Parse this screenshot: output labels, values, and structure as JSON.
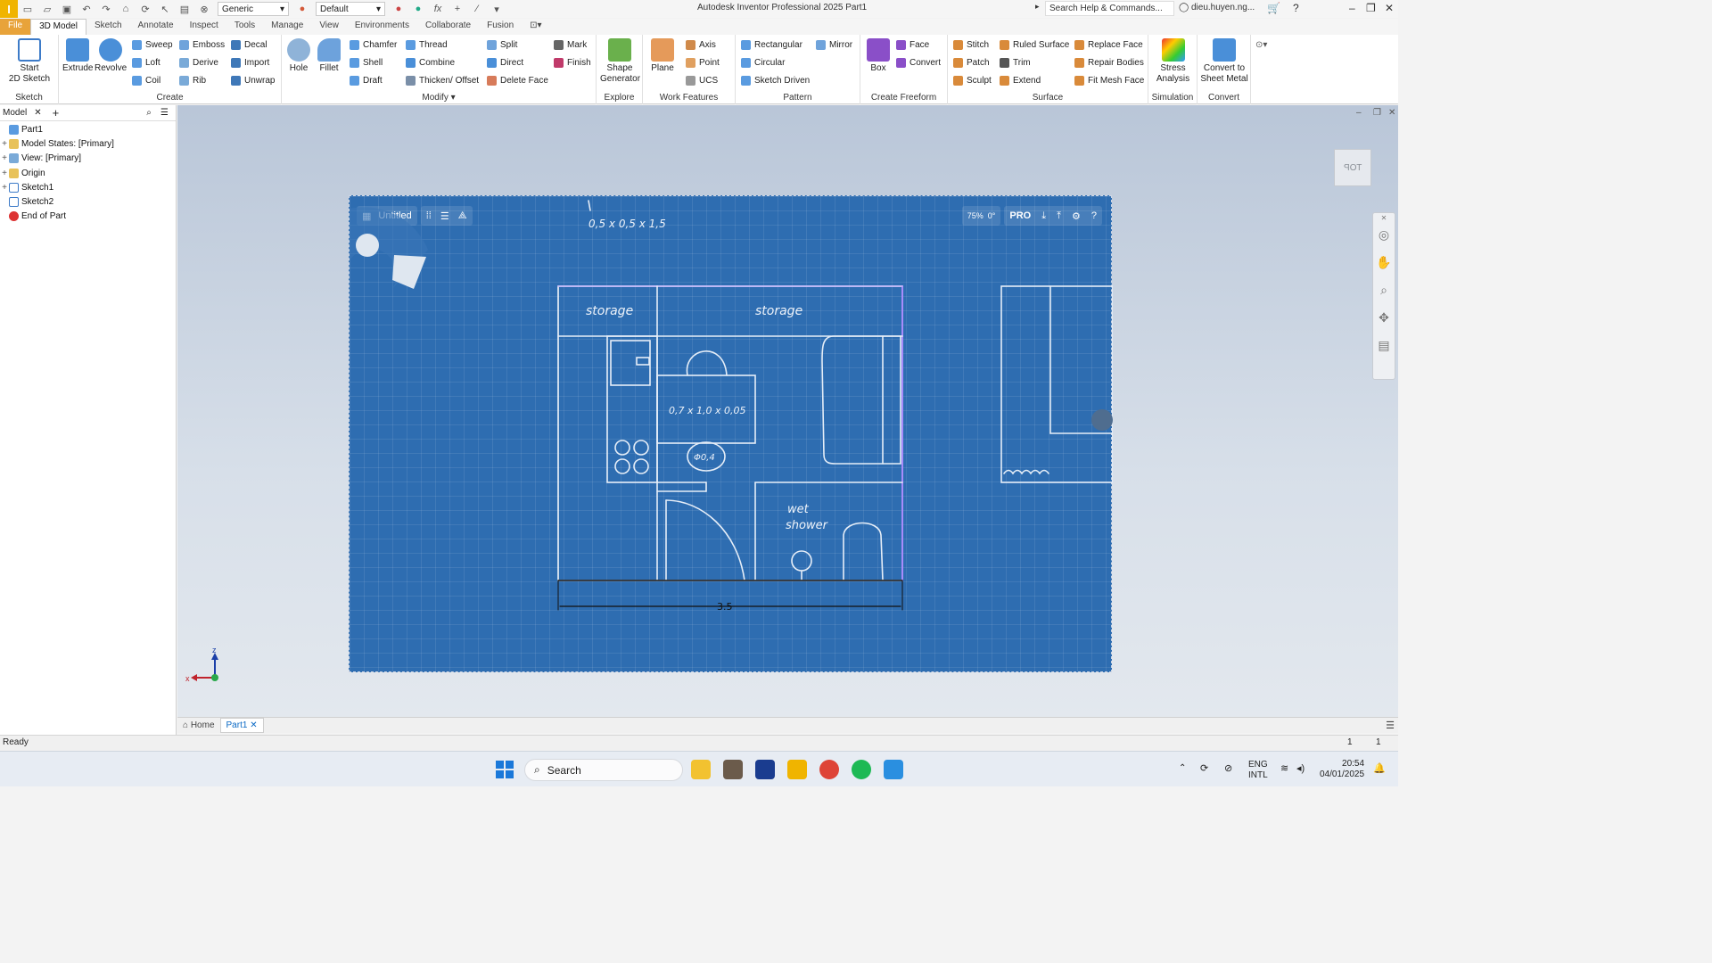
{
  "titlebar": {
    "material": "Generic",
    "appearance": "Default",
    "title": "Autodesk Inventor Professional 2025     Part1",
    "search_placeholder": "Search Help & Commands...",
    "user": "dieu.huyen.ng...",
    "fx_symbol": "fx"
  },
  "tabs": [
    "File",
    "3D Model",
    "Sketch",
    "Annotate",
    "Inspect",
    "Tools",
    "Manage",
    "View",
    "Environments",
    "Collaborate",
    "Fusion"
  ],
  "ribbon": {
    "sketch": {
      "label": "Sketch",
      "start": "Start",
      "start2": "2D Sketch"
    },
    "create": {
      "label": "Create",
      "extrude": "Extrude",
      "revolve": "Revolve",
      "sweep": "Sweep",
      "emboss": "Emboss",
      "decal": "Decal",
      "loft": "Loft",
      "derive": "Derive",
      "import": "Import",
      "coil": "Coil",
      "rib": "Rib",
      "unwrap": "Unwrap"
    },
    "modify": {
      "label": "Modify",
      "hole": "Hole",
      "fillet": "Fillet",
      "chamfer": "Chamfer",
      "thread": "Thread",
      "split": "Split",
      "shell": "Shell",
      "combine": "Combine",
      "direct": "Direct",
      "draft": "Draft",
      "thicken": "Thicken/ Offset",
      "delete_face": "Delete Face"
    },
    "explore": {
      "label": "Explore",
      "mark": "Mark",
      "finish": "Finish",
      "shape": "Shape",
      "generator": "Generator"
    },
    "work": {
      "label": "Work Features",
      "plane": "Plane",
      "axis": "Axis",
      "point": "Point",
      "ucs": "UCS"
    },
    "pattern": {
      "label": "Pattern",
      "rectangular": "Rectangular",
      "mirror": "Mirror",
      "circular": "Circular",
      "sketch_driven": "Sketch Driven"
    },
    "freeform": {
      "label": "Create Freeform",
      "box": "Box",
      "face": "Face",
      "convert": "Convert"
    },
    "surface": {
      "label": "Surface",
      "stitch": "Stitch",
      "ruled": "Ruled Surface",
      "replace": "Replace Face",
      "patch": "Patch",
      "trim": "Trim",
      "repair": "Repair Bodies",
      "sculpt": "Sculpt",
      "extend": "Extend",
      "fit_mesh": "Fit Mesh Face"
    },
    "simulation": {
      "label": "Simulation",
      "stress": "Stress",
      "analysis": "Analysis"
    },
    "convert_panel": {
      "label": "Convert",
      "convert_to": "Convert to",
      "sheet_metal": "Sheet Metal"
    }
  },
  "browser": {
    "tab_label": "Model",
    "items": [
      "Part1",
      "Model States: [Primary]",
      "View: [Primary]",
      "Origin",
      "Sketch1",
      "Sketch2",
      "End of Part"
    ]
  },
  "viewport": {
    "drawing_title": "Untitled",
    "zoom": "75%",
    "angle": "0°",
    "plan": "PRO",
    "viewcube_label": "TOP",
    "dim_top": "0,5 x 0,5 x 1,5",
    "room_storage_left": "storage",
    "room_storage_right": "storage",
    "table_dim": "0,7 x 1,0 x 0,05",
    "round_dim": "Φ0,4",
    "wet_shower_1": "wet",
    "wet_shower_2": "shower",
    "bottom_dim": "3.5",
    "axis_z": "z",
    "axis_x": "x"
  },
  "doc_tabs": {
    "home": "Home",
    "part": "Part1"
  },
  "status": {
    "text": "Ready",
    "n1": "1",
    "n2": "1"
  },
  "taskbar": {
    "search": "Search",
    "lang1": "ENG",
    "lang2": "INTL",
    "time": "20:54",
    "date": "04/01/2025"
  },
  "colors": {
    "blueprint": "#2e6db1",
    "file_tab": "#e8a33a",
    "accent": "#0a69c4"
  }
}
